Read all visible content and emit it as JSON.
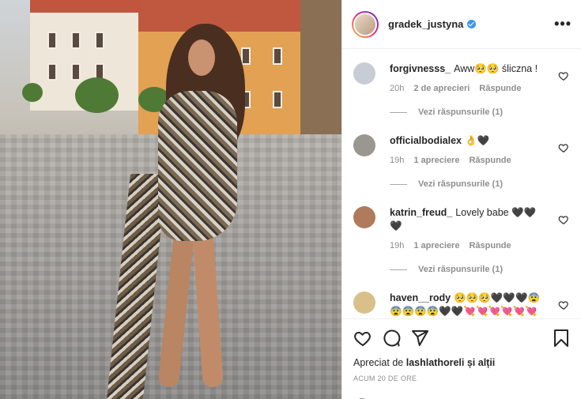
{
  "post": {
    "username": "gradek_justyna",
    "verified": true,
    "more_label": "•••"
  },
  "comments": [
    {
      "username": "forgivnesss_",
      "text": "Aww🥺🥺 śliczna !",
      "time": "20h",
      "likes": "2 de aprecieri",
      "reply": "Răspunde",
      "view_replies": "Vezi răspunsurile (1)",
      "avatar_color": "#c8ccd4"
    },
    {
      "username": "officialbodialex",
      "text": "👌🖤",
      "time": "19h",
      "likes": "1 apreciere",
      "reply": "Răspunde",
      "view_replies": "Vezi răspunsurile (1)",
      "avatar_color": "#9a9690"
    },
    {
      "username": "katrin_freud_",
      "text": "Lovely babe 🖤🖤🖤",
      "time": "19h",
      "likes": "1 apreciere",
      "reply": "Răspunde",
      "view_replies": "Vezi răspunsurile (1)",
      "avatar_color": "#b07a5c"
    },
    {
      "username": "haven__rody",
      "text": "🥺🥺🥺🖤🖤🖤😨😨😨😨😨🖤🖤💘💘💘💘💘💘💘💘🥰🥰🥰😍😍😍😍💔",
      "avatar_color": "#d9c08a"
    }
  ],
  "actions": {
    "liked_prefix": "Apreciat de",
    "liked_user": "lashlathoreli",
    "liked_suffix": "și alții",
    "timestamp": "ACUM 20 DE ORE"
  },
  "icons": {
    "heart": "heart-icon",
    "comment": "comment-icon",
    "share": "share-icon",
    "save": "bookmark-icon"
  },
  "colors": {
    "verified": "#3897f0",
    "text": "#262626",
    "muted": "#8e8e8e"
  }
}
